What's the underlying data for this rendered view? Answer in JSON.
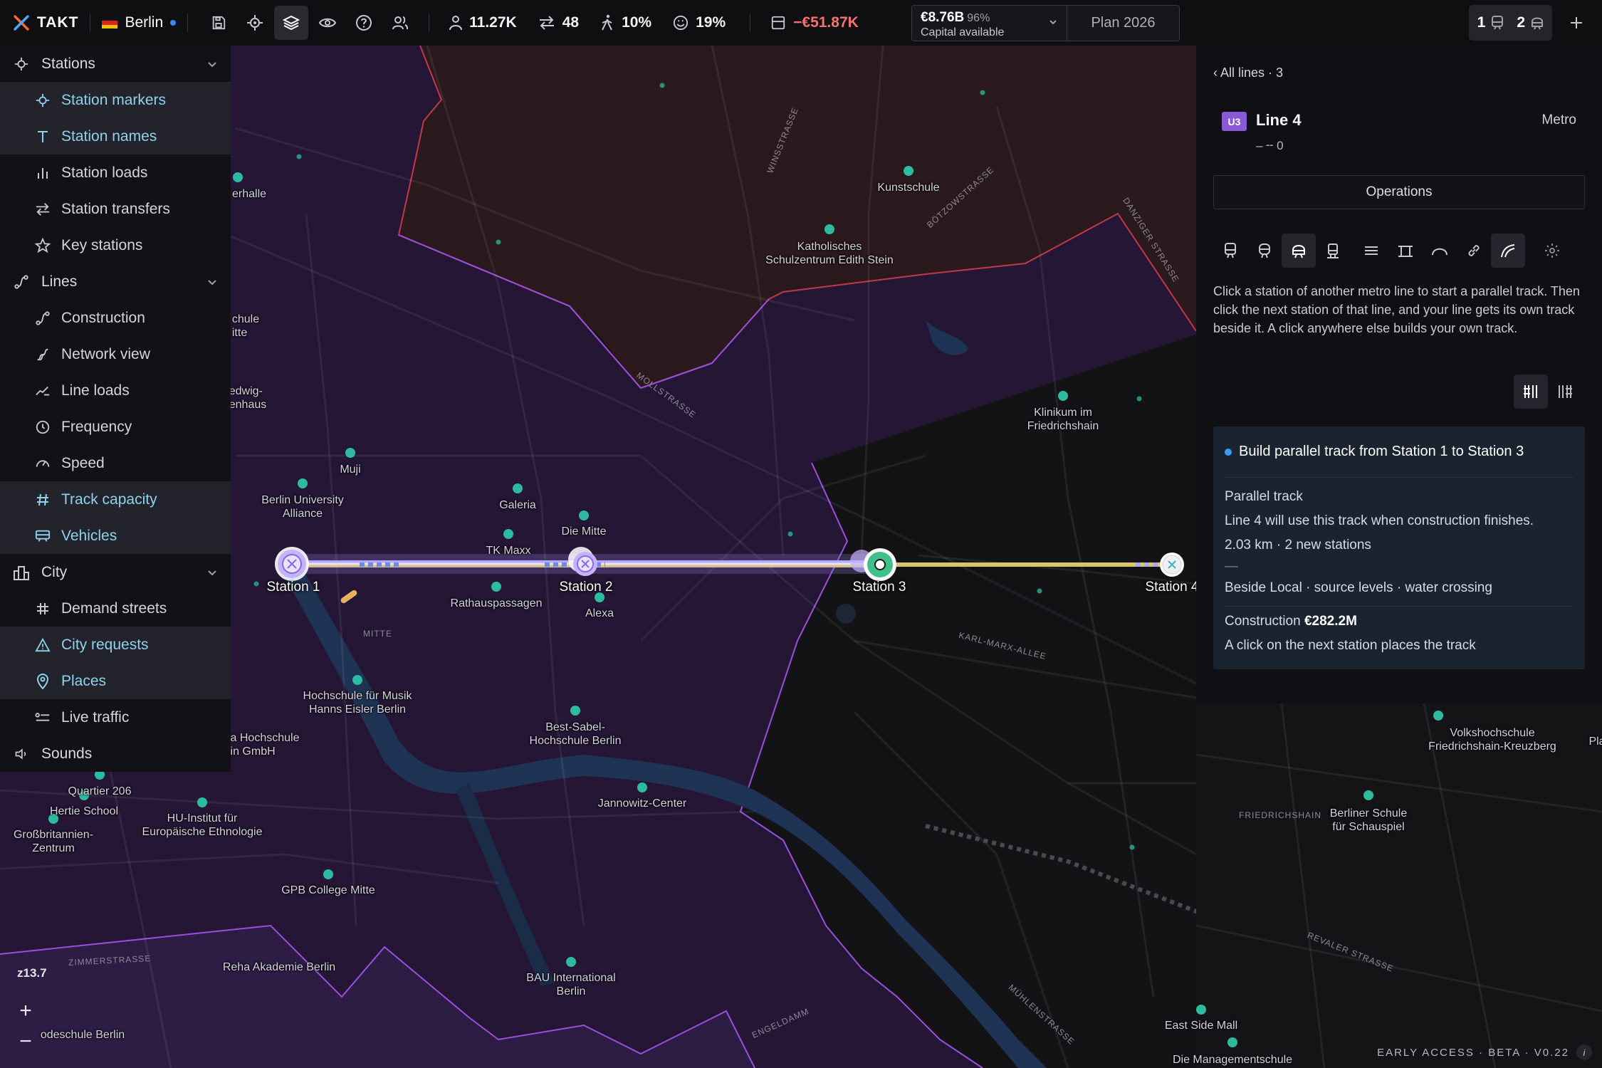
{
  "topbar": {
    "brand": "TAKT",
    "city": "Berlin",
    "stats": [
      {
        "icon": "person-icon",
        "value": "11.27K"
      },
      {
        "icon": "transfer-arrows-icon",
        "value": "48"
      },
      {
        "icon": "walking-icon",
        "value": "10%"
      },
      {
        "icon": "smiley-icon",
        "value": "19%"
      },
      {
        "icon": "wallet-icon",
        "value": "−€51.87K"
      }
    ],
    "budget": {
      "amount": "€8.76B",
      "percent": "96%",
      "caption": "Capital available"
    },
    "plan": "Plan 2026",
    "counters": {
      "metro": "1",
      "bus": "2"
    }
  },
  "sidebar": {
    "stations": {
      "label": "Stations",
      "items": [
        "Station markers",
        "Station names",
        "Station loads",
        "Station transfers",
        "Key stations"
      ]
    },
    "lines": {
      "label": "Lines",
      "items": [
        "Construction",
        "Network view",
        "Line loads",
        "Frequency",
        "Speed",
        "Track capacity",
        "Vehicles"
      ]
    },
    "city": {
      "label": "City",
      "items": [
        "Demand streets",
        "City requests",
        "Places",
        "Live traffic"
      ]
    },
    "sounds": "Sounds"
  },
  "panel": {
    "back": "‹ All lines · 3",
    "badge": "U3",
    "title": "Line 4",
    "type": "Metro",
    "subtitle": "– ╌ 0",
    "operations": "Operations",
    "help": "Click a station of another metro line to start a parallel track. Then click the next station of that line, and your line gets its own track beside it. A click anywhere else builds your own track.",
    "card": {
      "heading": "Build parallel track from Station 1 to Station 3",
      "kind": "Parallel track",
      "note": "Line 4 will use this track when construction finishes.",
      "length": "2.03 km · 2 new stations",
      "dash": "—",
      "details": "Beside Local · source levels · water crossing",
      "construction_label": "Construction",
      "construction_value": "€282.2M",
      "hint": "A click on the next station places the track"
    }
  },
  "map": {
    "zoom": "z13.7",
    "zoom_in": "+",
    "zoom_out": "−",
    "beta": "EARLY ACCESS · BETA · V0.22",
    "info": "i",
    "stations": [
      "Station 1",
      "Station 2",
      "Station 3",
      "Station 4"
    ],
    "places": {
      "erhalle": "erhalle",
      "kunstschule": "Kunstschule",
      "katholisches": "Katholisches\nSchulzentrum Edith Stein",
      "chule": "chule\nitte",
      "edwig": "edwig-\nenhaus",
      "klinikum": "Klinikum im\nFriedrichshain",
      "muji": "Muji",
      "bua": "Berlin University\nAlliance",
      "galeria": "Galeria",
      "diemitte": "Die Mitte",
      "tkmaxx": "TK Maxx",
      "rathaus": "Rathauspassagen",
      "alexa": "Alexa",
      "hfm": "Hochschule für Musik\nHanns Eisler Berlin",
      "bestsabel": "Best-Sabel-\nHochschule Berlin",
      "ahoch": "a Hochschule\nin GmbH",
      "quartier": "Quartier 206",
      "hertie": "Hertie School",
      "hu": "HU-Institut für\nEuropäische Ethnologie",
      "gross": "Großbritannien-\nZentrum",
      "jannowitz": "Jannowitz-Center",
      "gpb": "GPB College Mitte",
      "reha": "Reha Akademie Berlin",
      "bau": "BAU International\nBerlin",
      "deschule": "odeschule Berlin",
      "volks": "Volkshochschule\nFriedrichshain-Kreuzberg",
      "pla": "Pla",
      "berliner": "Berliner Schule\nfür Schauspiel",
      "eastside": "East Side Mall",
      "management": "Die Managementschule"
    },
    "streets": {
      "winsstrasse": "WINSSTRASSE",
      "boetzow": "BÖTZOWSTRASSE",
      "danziger": "DANZIGER STRASSE",
      "moll": "MOLLSTRASSE",
      "mitte": "MITTE",
      "karlmarx": "KARL-MARX-ALLEE",
      "friedrichshain": "FRIEDRICHSHAIN",
      "revaler": "REVALER STRASSE",
      "zimmer": "ZIMMERSTRASSE",
      "muehlen": "MÜHLENSTRASSE",
      "engeldamm": "ENGELDAMM"
    },
    "colors": {
      "mitte_district": "#2a1a3d",
      "pberg_district": "#2e1a1e",
      "track_existing": "#9a86e8",
      "track_new": "#d9c56c",
      "poi": "#2ec4a6",
      "water": "#1f3354"
    }
  }
}
